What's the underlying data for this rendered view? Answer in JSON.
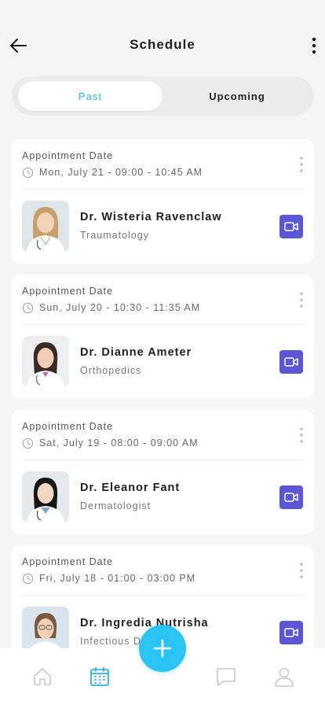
{
  "header": {
    "title": "Schedule"
  },
  "tabs": {
    "past": "Past",
    "upcoming": "Upcoming"
  },
  "appointments": [
    {
      "label": "Appointment Date",
      "date": "Mon, July 21 - 09:00 - 10:45 AM",
      "doctor": "Dr. Wisteria Ravenclaw",
      "specialty": "Traumatology"
    },
    {
      "label": "Appointment Date",
      "date": "Sun, July 20 - 10:30 - 11:35 AM",
      "doctor": "Dr. Dianne Ameter",
      "specialty": "Orthopedics"
    },
    {
      "label": "Appointment Date",
      "date": "Sat, July 19 - 08:00 - 09:00 AM",
      "doctor": "Dr. Eleanor Fant",
      "specialty": "Dermatologist"
    },
    {
      "label": "Appointment Date",
      "date": "Fri, July 18 - 01:00 - 03:00 PM",
      "doctor": "Dr. Ingredia Nutrisha",
      "specialty": "Infectious Diseases"
    }
  ],
  "nav": {
    "items": [
      "home-icon",
      "calendar-icon",
      "add-icon",
      "chat-icon",
      "profile-icon"
    ],
    "active": "calendar-icon"
  },
  "colors": {
    "accent": "#29b6e6",
    "fab": "#29c4f4",
    "video": "#5a56d6",
    "background": "#f5f5f5"
  }
}
